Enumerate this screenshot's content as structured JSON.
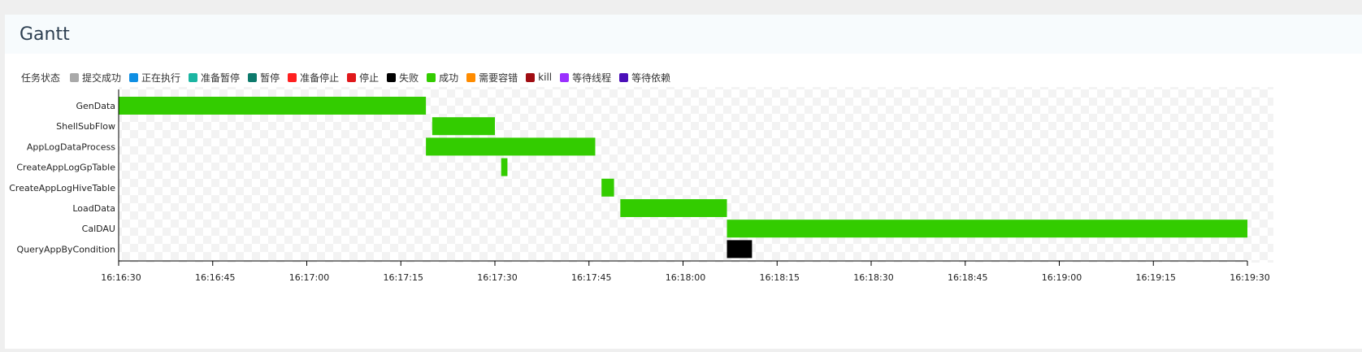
{
  "header": {
    "title": "Gantt"
  },
  "legend": {
    "title": "任务状态",
    "items": [
      {
        "label": "提交成功",
        "color": "#a9a9a9"
      },
      {
        "label": "正在执行",
        "color": "#0f8fe3"
      },
      {
        "label": "准备暂停",
        "color": "#1bb5a2"
      },
      {
        "label": "暂停",
        "color": "#0d7a6c"
      },
      {
        "label": "准备停止",
        "color": "#ff2020"
      },
      {
        "label": "停止",
        "color": "#e0181b"
      },
      {
        "label": "失败",
        "color": "#000000"
      },
      {
        "label": "成功",
        "color": "#33cc00"
      },
      {
        "label": "需要容错",
        "color": "#ff8c00"
      },
      {
        "label": "kill",
        "color": "#a00d12"
      },
      {
        "label": "等待线程",
        "color": "#9b30ff"
      },
      {
        "label": "等待依赖",
        "color": "#4b0fb8"
      }
    ]
  },
  "chart_data": {
    "type": "gantt",
    "x_range": [
      "16:16:30",
      "16:19:30"
    ],
    "x_ticks": [
      "16:16:30",
      "16:16:45",
      "16:17:00",
      "16:17:15",
      "16:17:30",
      "16:17:45",
      "16:18:00",
      "16:18:15",
      "16:18:30",
      "16:18:45",
      "16:19:00",
      "16:19:15",
      "16:19:30"
    ],
    "tasks": [
      {
        "name": "GenData",
        "start": "16:16:30",
        "end": "16:17:19",
        "status": "成功",
        "color": "#33cc00"
      },
      {
        "name": "ShellSubFlow",
        "start": "16:17:20",
        "end": "16:17:30",
        "status": "成功",
        "color": "#33cc00"
      },
      {
        "name": "AppLogDataProcess",
        "start": "16:17:19",
        "end": "16:17:46",
        "status": "成功",
        "color": "#33cc00"
      },
      {
        "name": "CreateAppLogGpTable",
        "start": "16:17:31",
        "end": "16:17:32",
        "status": "成功",
        "color": "#33cc00"
      },
      {
        "name": "CreateAppLogHiveTable",
        "start": "16:17:47",
        "end": "16:17:49",
        "status": "成功",
        "color": "#33cc00"
      },
      {
        "name": "LoadData",
        "start": "16:17:50",
        "end": "16:18:07",
        "status": "成功",
        "color": "#33cc00"
      },
      {
        "name": "CalDAU",
        "start": "16:18:07",
        "end": "16:19:30",
        "status": "成功",
        "color": "#33cc00"
      },
      {
        "name": "QueryAppByCondition",
        "start": "16:18:07",
        "end": "16:18:11",
        "status": "失败",
        "color": "#000000"
      }
    ]
  }
}
